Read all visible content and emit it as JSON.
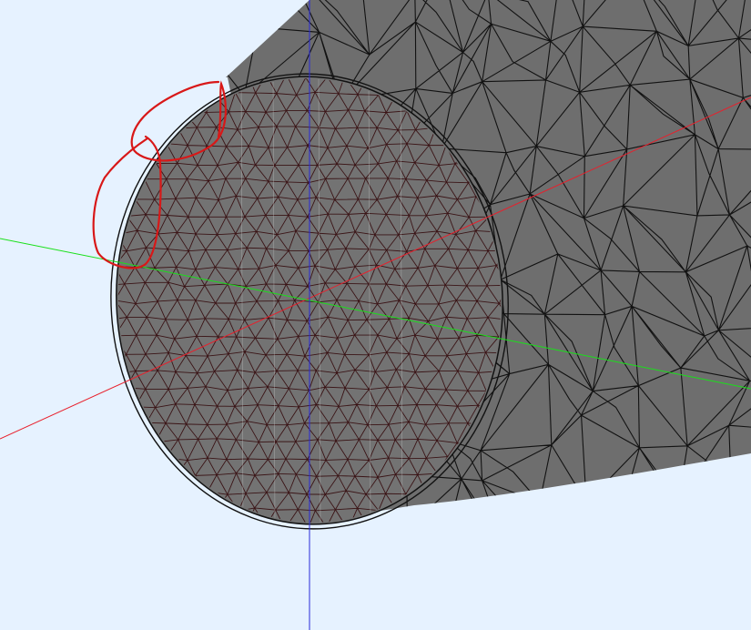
{
  "viewport": {
    "background": "#e6f2ff"
  },
  "mesh": {
    "fill": "#6e6e6e",
    "cap_fill": "#737373",
    "edge_color": "#121212",
    "cap_edge_color": "#3a1416",
    "highlight_color": "#c8c8c8"
  },
  "axes": {
    "x_color": "#e8202c",
    "y_color": "#19e019",
    "z_color": "#2a2ad8"
  },
  "annotation": {
    "stroke_color": "#d81818",
    "description_icon": "hand-drawn-circle-markup"
  }
}
